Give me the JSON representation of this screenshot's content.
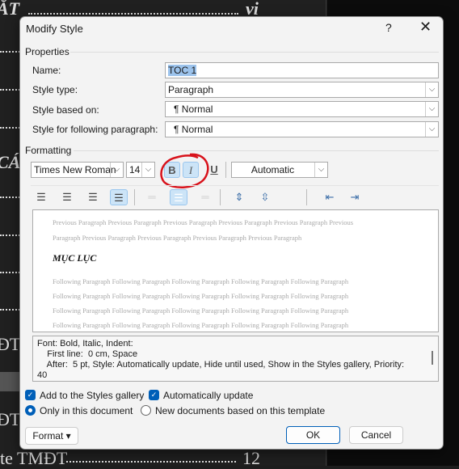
{
  "background": {
    "top_text": "ẮT",
    "top_page": "vi",
    "mid_text": "CÁ",
    "lower_text1": "ĐT",
    "lower_text2": "ĐT .",
    "bottom_text": "te TMĐT",
    "bottom_page": "12"
  },
  "dialog": {
    "title": "Modify Style",
    "help": "?",
    "close": "✕",
    "properties": {
      "heading": "Properties",
      "name_label": "Name:",
      "name_value": "TOC 1",
      "style_type_label": "Style type:",
      "style_type_value": "Paragraph",
      "based_on_label": "Style based on:",
      "based_on_value": "¶  Normal",
      "following_label": "Style for following paragraph:",
      "following_value": "¶  Normal"
    },
    "formatting": {
      "heading": "Formatting",
      "font": "Times New Roman",
      "size": "14",
      "bold": "B",
      "italic": "I",
      "underline": "U",
      "color": "Automatic",
      "bold_on": true,
      "italic_on": true
    },
    "preview": {
      "previous": [
        "Previous Paragraph Previous Paragraph Previous Paragraph Previous Paragraph Previous Paragraph Previous",
        "Paragraph Previous Paragraph Previous Paragraph Previous Paragraph Previous Paragraph"
      ],
      "sample": "MỤC LỤC",
      "following": [
        "Following Paragraph Following Paragraph Following Paragraph Following Paragraph Following Paragraph",
        "Following Paragraph Following Paragraph Following Paragraph Following Paragraph Following Paragraph",
        "Following Paragraph Following Paragraph Following Paragraph Following Paragraph Following Paragraph",
        "Following Paragraph Following Paragraph Following Paragraph Following Paragraph Following Paragraph"
      ]
    },
    "description": [
      "Font: Bold, Italic, Indent:",
      "    First line:  0 cm, Space",
      "    After:  5 pt, Style: Automatically update, Hide until used, Show in the Styles gallery, Priority:",
      "40"
    ],
    "options": {
      "add_gallery": "Add to the Styles gallery",
      "auto_update": "Automatically update",
      "only_doc": "Only in this document",
      "new_docs": "New documents based on this template"
    },
    "buttons": {
      "format": "Format ▾",
      "ok": "OK",
      "cancel": "Cancel"
    },
    "colors": {
      "accent": "#005fb8",
      "annotation": "#d8121b"
    }
  }
}
